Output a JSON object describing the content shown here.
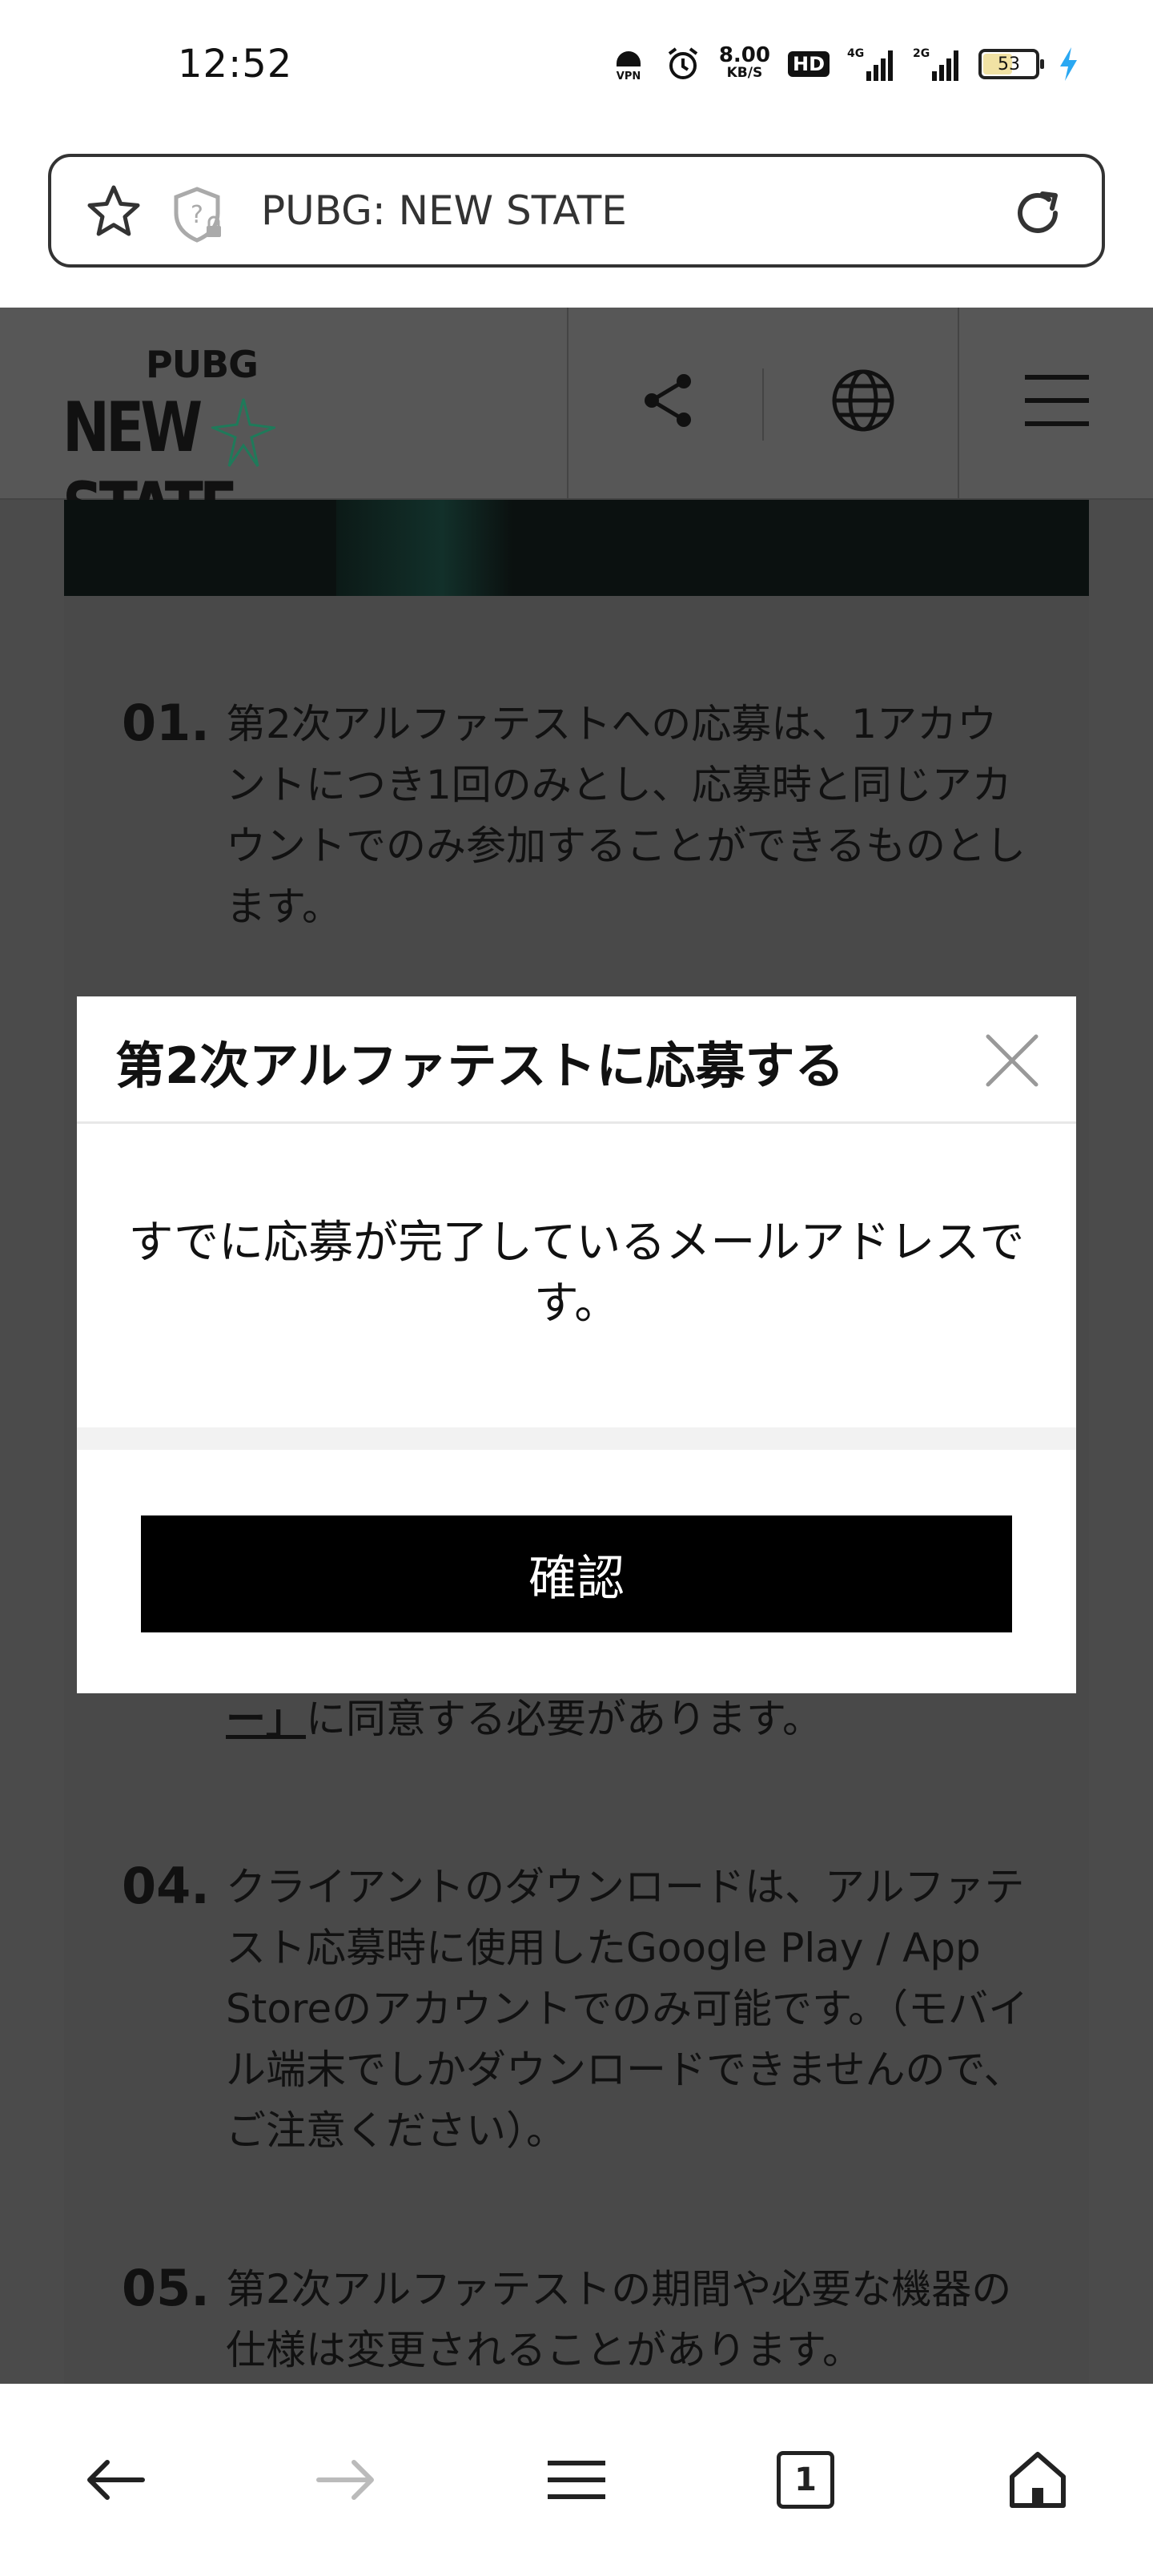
{
  "status_bar": {
    "time": "12:52",
    "vpn_label": "VPN",
    "speed_value": "8.00",
    "speed_unit": "KB/S",
    "hd_label": "HD",
    "net1_label": "4G",
    "net2_label": "2G",
    "battery_level": "53",
    "battery_fraction": 0.53,
    "charging": true
  },
  "browser": {
    "url_title": "PUBG: NEW STATE"
  },
  "site": {
    "logo_top": "PUBG",
    "logo_main": "NEW STATE"
  },
  "content": {
    "items": [
      {
        "num": "01.",
        "text": "第2次アルファテストへの応募は、1アカウントにつき1回のみとし、応募時と同じアカウントでのみ参加することができるものとします。"
      },
      {
        "num": "04.",
        "text": "クライアントのダウンロードは、アルファテスト応募時に使用したGoogle Play / App Storeのアカウントでのみ可能です。（モバイル端末でしかダウンロードできませんので、ご注意ください）。"
      },
      {
        "num": "05.",
        "text": "第2次アルファテストの期間や必要な機器の仕様は変更されることがあります。"
      }
    ],
    "agree_underlined": "ー」",
    "agree_rest": "に同意する必要があります。"
  },
  "modal": {
    "title": "第2次アルファテストに応募する",
    "message": "すでに応募が完了しているメールアドレスです。",
    "confirm_label": "確認"
  },
  "colors": {
    "overlay_page": "#4b4b4b",
    "modal_bg": "#ffffff",
    "confirm_bg": "#000000",
    "charging_bolt": "#2aa8f2",
    "logo_accent": "#1f7a5a"
  }
}
